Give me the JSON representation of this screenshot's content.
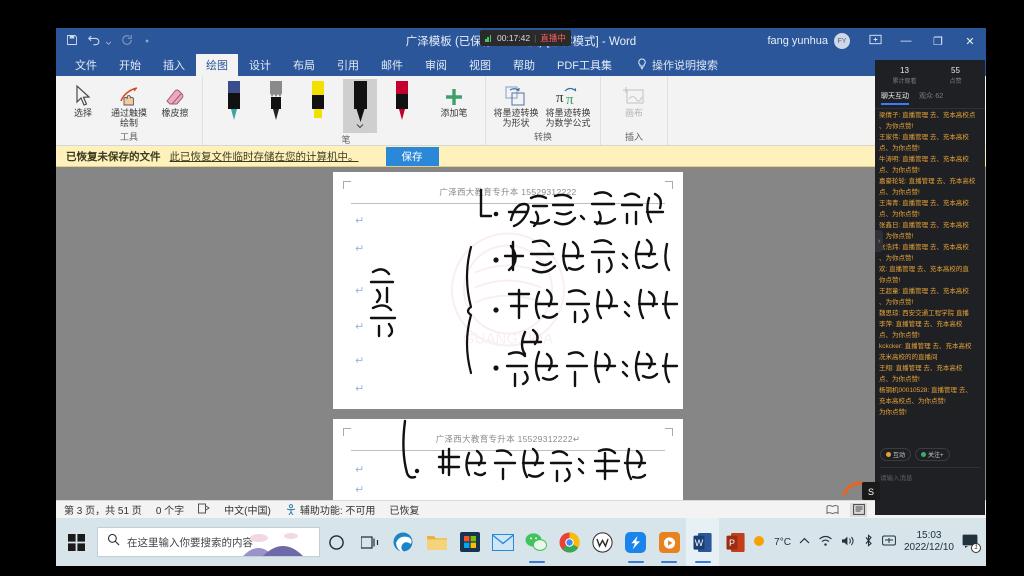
{
  "app": {
    "title": "广泽模板 (已保存到此电脑) [兼容模式]  -  Word",
    "account_name": "fang yunhua",
    "avatar_initials": "FY",
    "accent": "#2b579a"
  },
  "live_overlay": {
    "timer": "00:17:42",
    "separator": "|",
    "status": "直播中"
  },
  "quick_access": {
    "save": "save-icon",
    "undo": "undo-icon",
    "redo": "redo-icon",
    "more": "more-icon"
  },
  "window_controls": {
    "share": "share-icon",
    "minimize": "—",
    "restore": "❐",
    "close": "✕"
  },
  "menu": {
    "items": [
      {
        "label": "文件",
        "active": false
      },
      {
        "label": "开始",
        "active": false
      },
      {
        "label": "插入",
        "active": false
      },
      {
        "label": "绘图",
        "active": true
      },
      {
        "label": "设计",
        "active": false
      },
      {
        "label": "布局",
        "active": false
      },
      {
        "label": "引用",
        "active": false
      },
      {
        "label": "邮件",
        "active": false
      },
      {
        "label": "审阅",
        "active": false
      },
      {
        "label": "视图",
        "active": false
      },
      {
        "label": "帮助",
        "active": false
      },
      {
        "label": "PDF工具集",
        "active": false
      }
    ],
    "search_label": "操作说明搜索",
    "search_icon": "lightbulb-icon"
  },
  "ribbon": {
    "groups": [
      {
        "title": "工具",
        "items": [
          {
            "label": "选择",
            "icon": "cursor-arrow-icon",
            "dim": false
          },
          {
            "label": "通过触摸绘制",
            "icon": "touch-draw-icon",
            "dim": false
          },
          {
            "label": "橡皮擦",
            "icon": "eraser-icon",
            "dim": false
          }
        ]
      },
      {
        "title": "笔",
        "pens": [
          {
            "name": "pen-galaxy",
            "color": "#3c4d8c",
            "tip": "#3aa6a6",
            "selected": false
          },
          {
            "name": "pencil-gray",
            "color": "#808080",
            "tip": "#444444",
            "selected": false
          },
          {
            "name": "highlighter-yellow",
            "color": "#f2e000",
            "tip": "#f2e000",
            "selected": false
          },
          {
            "name": "pen-black",
            "color": "#111111",
            "tip": "#111111",
            "selected": true
          },
          {
            "name": "pen-red",
            "color": "#c3002f",
            "tip": "#c3002f",
            "selected": false
          }
        ],
        "add_pen_label": "添加笔",
        "add_pen_icon": "plus-icon"
      },
      {
        "title": "转换",
        "items": [
          {
            "label": "将墨迹转换为形状",
            "icon": "ink-to-shape-icon",
            "dim": false
          },
          {
            "label": "将墨迹转换为数学公式",
            "icon": "ink-to-math-icon",
            "dim": false
          }
        ]
      },
      {
        "title": "插入",
        "items": [
          {
            "label": "画布",
            "icon": "canvas-icon",
            "dim": true
          }
        ]
      }
    ]
  },
  "message_bar": {
    "title": "已恢复未保存的文件",
    "text": "此已恢复文件临时存储在您的计算机中。",
    "button": "保存"
  },
  "document": {
    "pages": [
      {
        "header": "广泽西大教育专升本    15529312222",
        "ink_lines": [
          "1. 功高贲薄、赏罚不公",
          "2. 杀霸陵尉：负能使性",
          "3. 中石没镞：臂力无比",
          "4. 家无余财：清正廉洁",
          "结构/描写"
        ]
      },
      {
        "header": "广泽西大教育专升本    15529312222↵",
        "ink_lines": [
          "1. 画地为军阵：善财"
        ]
      }
    ],
    "watermark": "广西大"
  },
  "status_bar": {
    "page": "第 3 页，共 51 页",
    "words": "0 个字",
    "proof_icon": "proofing-icon",
    "language": "中文(中国)",
    "accessibility_icon": "accessibility-icon",
    "accessibility": "辅助功能: 不可用",
    "recovered": "已恢复",
    "views": [
      {
        "name": "read-mode",
        "icon": "book-icon",
        "active": false
      },
      {
        "name": "print-layout",
        "icon": "page-icon",
        "active": true
      },
      {
        "name": "web-layout",
        "icon": "web-icon",
        "active": false
      }
    ],
    "zoom_minus": "−",
    "zoom_plus": "+"
  },
  "live_panel": {
    "stats": [
      {
        "value": "13",
        "label": "累计观看"
      },
      {
        "value": "55",
        "label": "点赞"
      }
    ],
    "tabs": [
      {
        "label": "聊天互动",
        "active": true
      },
      {
        "label": "观众·62",
        "active": false
      }
    ],
    "messages": [
      "梁倩子: 直播管理 去、充本高校点",
      "、为你点赞!",
      "王家伟: 直播管理 去、充本高校",
      "点、为你点赞!",
      "牛涛明: 直播管理 去、充本高校",
      "点、为你点赞!",
      "嘉豪轮轮: 直播管理 去、充本高校",
      "点、为你点赞!",
      "王海青: 直播管理 去、充本高校",
      "点、为你点赞!",
      "张鑫日: 直播管理 去、充本高校",
      "、为你点赞!",
      "张浩炜: 直播管理 去、充本高校",
      "、为你点赞!",
      "欢: 直播管理 去、充本高校的直",
      "你点赞!",
      "王超童: 直播管理 去、充本高校",
      "、为你点赞!",
      "魏思琼: 西安交通工程学院  直播",
      "李萍: 直播管理 去、充本高校",
      "点、为你点赞!",
      "kckcker: 直播管理 去、充本高校",
      "冼米高校的的直播间",
      "王翔: 直播管理 去、充本高校",
      "点、为你点赞!",
      "杨钢机00010528: 直播管理 去、",
      "充本高校点、为你点赞!",
      "为你点赞!"
    ],
    "chips": [
      {
        "label": "互动",
        "color": "#e8a13a"
      },
      {
        "label": "关注+",
        "color": "#38b06a"
      }
    ],
    "input_placeholder": "请输入消息",
    "collapse_icon": "chevron-right-icon"
  },
  "taskbar": {
    "start_icon": "windows-start-icon",
    "search_placeholder": "在这里输入你要搜索的内容",
    "search_icon": "search-icon",
    "cortana_icon": "cortana-icon",
    "taskview_icon": "task-view-icon",
    "apps": [
      {
        "name": "edge-icon",
        "color": "#1b84c8",
        "running": false
      },
      {
        "name": "file-explorer-icon",
        "color": "#e8b339",
        "running": false
      },
      {
        "name": "microsoft-store-icon",
        "color": "#1b3a57",
        "running": false
      },
      {
        "name": "mail-icon",
        "color": "#2b88d8",
        "running": false
      },
      {
        "name": "wechat-icon",
        "color": "#3fc45a",
        "running": true
      },
      {
        "name": "chrome-icon",
        "color": "#e94335",
        "running": false
      },
      {
        "name": "wps-icon",
        "color": "#ffffff",
        "running": false
      },
      {
        "name": "dingtalk-icon",
        "color": "#1b84ec",
        "running": true
      },
      {
        "name": "media-player-icon",
        "color": "#e8821f",
        "running": true
      },
      {
        "name": "word-icon",
        "color": "#2b579a",
        "running": true
      },
      {
        "name": "powerpoint-icon",
        "color": "#c43e1c",
        "running": false
      }
    ],
    "tray": {
      "weather_icon": "sun-icon",
      "weather": "7°C",
      "chevron": "⌃",
      "network_icon": "wifi-icon",
      "volume_icon": "speaker-icon",
      "bluetooth_icon": "bluetooth-icon",
      "ime_icon": "ime-icon",
      "time": "15:03",
      "date": "2022/12/10",
      "notification_icon": "notification-icon",
      "notification_count": "1"
    }
  }
}
